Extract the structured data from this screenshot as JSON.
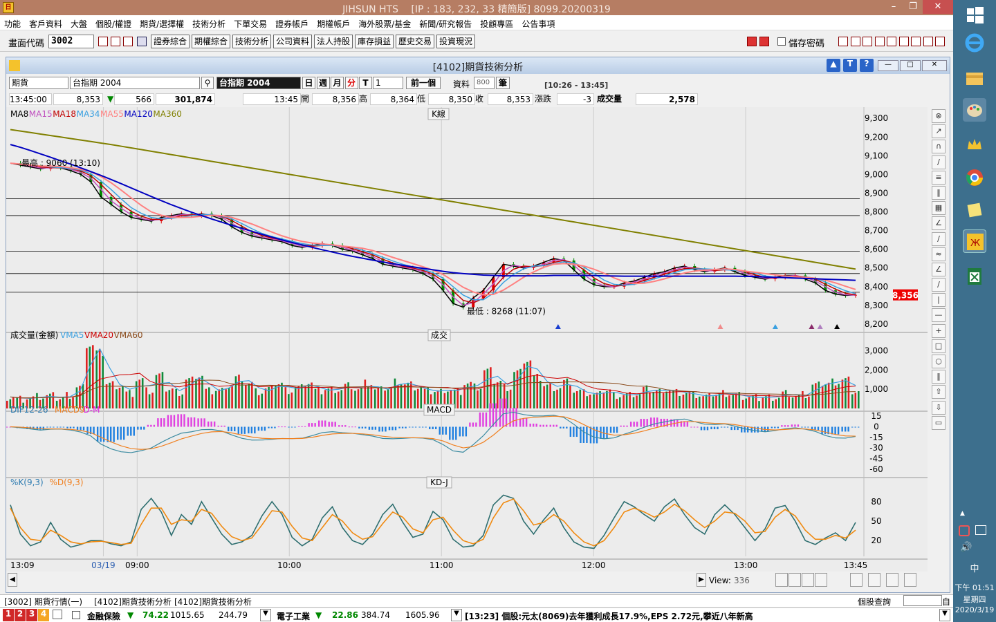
{
  "window": {
    "title": "JIHSUN HTS　 [IP : 183, 232, 33 精簡版] 8099.20200319"
  },
  "menu": [
    "功能",
    "客戶資料",
    "大盤",
    "個股/權證",
    "期貨/選擇權",
    "技術分析",
    "下單交易",
    "證券帳戶",
    "期權帳戶",
    "海外股票/基金",
    "新聞/研究報告",
    "投顧專區",
    "公告事項"
  ],
  "toolbar": {
    "code_label": "畫面代碼",
    "code_value": "3002",
    "buttons": [
      "證券綜合",
      "期權綜合",
      "技術分析",
      "公司資料",
      "法人持股",
      "庫存損益",
      "歷史交易",
      "投資現況"
    ],
    "save_pwd": "儲存密碼"
  },
  "child": {
    "title": "[4102]期貨技術分析"
  },
  "controls": {
    "type": "期貨",
    "symbol": "台指期 2004",
    "symbol_name": "台指期 2004",
    "periods": [
      "日",
      "週",
      "月",
      "分",
      "T"
    ],
    "interval": "1",
    "prev_btn": "前一個",
    "data_label": "資料",
    "data_count": "800",
    "data_unit": "筆",
    "time_range": "[10:26 - 13:45]"
  },
  "quote": {
    "time": "13:45:00",
    "last": "8,353",
    "change": "566",
    "volume_total": "301,874",
    "time2": "13:45",
    "open_label": "開",
    "open": "8,356",
    "high_label": "高",
    "high": "8,364",
    "low_label": "低",
    "low": "8,350",
    "close_label": "收",
    "close": "8,353",
    "chg_label": "漲跌",
    "chg": "-3",
    "vol_label": "成交量",
    "vol": "2,578"
  },
  "chart_data": [
    {
      "type": "line",
      "title": "K線",
      "legend": [
        "MA8",
        "MA15",
        "MA18",
        "MA34",
        "MA55",
        "MA120",
        "MA360"
      ],
      "legend_colors": [
        "#000000",
        "#c050c0",
        "#c00000",
        "#3aa0e0",
        "#ff8080",
        "#0000c0",
        "#808000"
      ],
      "y_ticks": [
        9300,
        9200,
        9100,
        9000,
        8900,
        8800,
        8700,
        8600,
        8500,
        8400,
        8300,
        8200
      ],
      "ylim": [
        8170,
        9360
      ],
      "last_price": "8,356",
      "annotations": [
        "最高 : 9060 (13:10)",
        "最低 : 8268 (11:07)"
      ],
      "x_ticks": [
        "13:09",
        "03/19",
        "09:00",
        "10:00",
        "11:00",
        "12:00",
        "13:00",
        "13:45"
      ],
      "close": [
        9060,
        9050,
        9040,
        9030,
        9040,
        9035,
        9020,
        9000,
        8960,
        8880,
        8840,
        8800,
        8770,
        8760,
        8750,
        8770,
        8780,
        8790,
        8780,
        8790,
        8780,
        8760,
        8720,
        8690,
        8670,
        8660,
        8650,
        8640,
        8620,
        8610,
        8620,
        8630,
        8620,
        8600,
        8590,
        8570,
        8550,
        8520,
        8510,
        8500,
        8490,
        8470,
        8440,
        8380,
        8310,
        8290,
        8340,
        8380,
        8450,
        8520,
        8510,
        8500,
        8510,
        8530,
        8550,
        8540,
        8490,
        8440,
        8410,
        8400,
        8400,
        8420,
        8430,
        8450,
        8470,
        8480,
        8500,
        8510,
        8490,
        8480,
        8490,
        8500,
        8480,
        8460,
        8450,
        8440,
        8450,
        8460,
        8460,
        8440,
        8420,
        8380,
        8360,
        8353,
        8356
      ],
      "series": [
        {
          "name": "MA120",
          "values": [
            9160,
            9145,
            9128,
            9110,
            9092,
            9073,
            9055,
            9035,
            9015,
            8995,
            8973,
            8951,
            8928,
            8905,
            8882,
            8860,
            8838,
            8818,
            8798,
            8780,
            8762,
            8745,
            8728,
            8712,
            8696,
            8680,
            8665,
            8650,
            8636,
            8623,
            8610,
            8597,
            8585,
            8573,
            8562,
            8552,
            8542,
            8532,
            8523,
            8514,
            8506,
            8498,
            8490,
            8482,
            8475,
            8470,
            8466,
            8462,
            8460,
            8458,
            8458,
            8458,
            8458,
            8458,
            8460,
            8460,
            8460,
            8460,
            8459,
            8458,
            8457,
            8456,
            8456,
            8456,
            8456,
            8456,
            8456,
            8456,
            8456,
            8456,
            8456,
            8456,
            8456,
            8455,
            8454,
            8452,
            8450,
            8448,
            8446,
            8444,
            8442,
            8440,
            8438,
            8436,
            8434
          ]
        },
        {
          "name": "MA360",
          "values": [
            9240,
            9232,
            9224,
            9216,
            9208,
            9200,
            9192,
            9184,
            9176,
            9168,
            9160,
            9151,
            9142,
            9133,
            9124,
            9115,
            9106,
            9097,
            9088,
            9079,
            9070,
            9061,
            9052,
            9043,
            9034,
            9025,
            9016,
            9007,
            8998,
            8989,
            8980,
            8971,
            8962,
            8953,
            8944,
            8935,
            8926,
            8917,
            8908,
            8899,
            8890,
            8881,
            8872,
            8863,
            8854,
            8845,
            8836,
            8827,
            8818,
            8809,
            8800,
            8791,
            8782,
            8773,
            8764,
            8755,
            8746,
            8737,
            8728,
            8719,
            8710,
            8701,
            8692,
            8683,
            8674,
            8665,
            8656,
            8647,
            8638,
            8629,
            8620,
            8611,
            8602,
            8593,
            8584,
            8575,
            8566,
            8557,
            8548,
            8539,
            8530,
            8521,
            8512,
            8503,
            8494
          ]
        }
      ]
    },
    {
      "type": "bar",
      "title": "成交",
      "legend": [
        "成交量(金額)",
        "VMA5",
        "VMA20",
        "VMA60"
      ],
      "y_ticks": [
        3000,
        2000,
        1000
      ],
      "ylim": [
        0,
        3600
      ],
      "values": [
        600,
        500,
        550,
        600,
        650,
        520,
        700,
        1100,
        3300,
        2900,
        1300,
        1200,
        800,
        1500,
        900,
        1700,
        1000,
        850,
        1500,
        1700,
        900,
        950,
        1200,
        1600,
        1300,
        850,
        1000,
        1300,
        950,
        1100,
        1350,
        900,
        1000,
        1000,
        1200,
        1000,
        1300,
        950,
        1050,
        1400,
        1250,
        1100,
        900,
        900,
        1000,
        900,
        1300,
        1100,
        1950,
        1400,
        1100,
        1900,
        2500,
        1600,
        1200,
        1100,
        1400,
        900,
        800,
        700,
        950,
        700,
        700,
        750,
        1000,
        900,
        1000,
        850,
        800,
        700,
        600,
        750,
        800,
        700,
        600,
        550,
        600,
        600,
        800,
        650,
        700,
        1200,
        1300,
        1400,
        1500,
        900
      ]
    },
    {
      "type": "bar",
      "title": "MACD",
      "legend": [
        "DIF12-26",
        "MACD9",
        "D-M"
      ],
      "y_ticks": [
        15,
        0,
        -15,
        -30,
        -45,
        -60
      ],
      "ylim": [
        -68,
        24
      ]
    },
    {
      "type": "line",
      "title": "KD-J",
      "legend": [
        "%K(9,3)",
        "%D(9,3)"
      ],
      "y_ticks": [
        80,
        50,
        20
      ],
      "ylim": [
        0,
        100
      ],
      "series": [
        {
          "name": "%K(9,3)",
          "values": [
            75,
            30,
            12,
            18,
            48,
            22,
            10,
            14,
            20,
            20,
            15,
            12,
            18,
            68,
            85,
            64,
            28,
            60,
            45,
            80,
            55,
            30,
            14,
            18,
            28,
            58,
            80,
            60,
            25,
            12,
            22,
            55,
            72,
            40,
            20,
            14,
            30,
            60,
            76,
            48,
            25,
            30,
            65,
            52,
            22,
            10,
            12,
            28,
            75,
            90,
            85,
            50,
            30,
            52,
            70,
            40,
            18,
            10,
            8,
            28,
            55,
            80,
            72,
            60,
            50,
            72,
            84,
            60,
            40,
            30,
            60,
            75,
            60,
            40,
            20,
            38,
            70,
            74,
            50,
            20,
            14,
            24,
            32,
            20,
            48
          ]
        },
        {
          "name": "%D(9,3)",
          "values": [
            70,
            40,
            22,
            20,
            36,
            28,
            18,
            15,
            18,
            19,
            17,
            14,
            16,
            45,
            70,
            70,
            45,
            52,
            50,
            68,
            62,
            42,
            26,
            20,
            24,
            44,
            66,
            64,
            42,
            24,
            20,
            40,
            60,
            50,
            32,
            22,
            26,
            46,
            64,
            56,
            38,
            32,
            52,
            56,
            36,
            20,
            15,
            22,
            55,
            78,
            84,
            66,
            44,
            48,
            60,
            50,
            32,
            18,
            12,
            20,
            40,
            64,
            70,
            64,
            56,
            64,
            76,
            66,
            52,
            40,
            50,
            64,
            62,
            50,
            32,
            34,
            56,
            68,
            58,
            36,
            22,
            22,
            28,
            24,
            36
          ]
        }
      ]
    }
  ],
  "view_label": "View:",
  "view_value": "336",
  "bottom_tabs": [
    "[3002] 期貨行情(一)",
    "[4102]期貨技術分析",
    "[4102]期貨技術分析"
  ],
  "stock_query": "個股查詢",
  "status": {
    "nums": [
      "1",
      "2",
      "3",
      "4"
    ],
    "sector1": "金融保險",
    "sector1_v1": "74.22",
    "sector1_v2": "1015.65",
    "sector1_v3": "244.79",
    "sector2": "電子工業",
    "sector2_v1": "22.86",
    "sector2_v2": "384.74",
    "sector2_v3": "1605.96",
    "news": "[13:23] 個股:元太(8069)去年獲利成長17.9%,EPS 2.72元,攀近八年新高"
  },
  "clock": {
    "time": "下午 01:51",
    "weekday": "星期四",
    "date": "2020/3/19",
    "ime": "中"
  }
}
